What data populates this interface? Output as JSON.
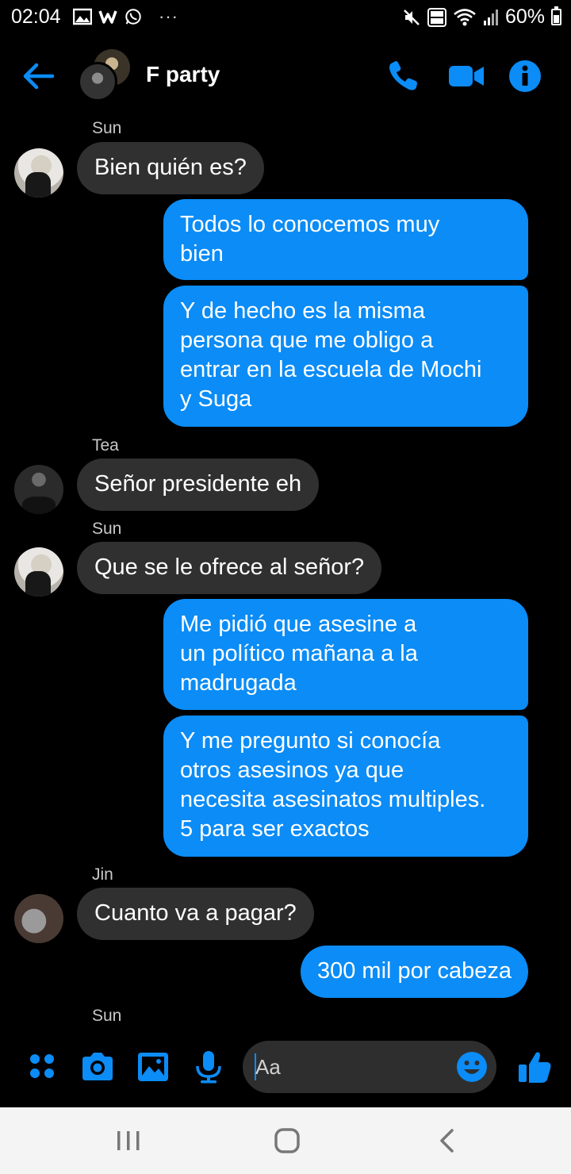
{
  "status_bar": {
    "time": "02:04",
    "battery": "60%",
    "battery_level": 0.6,
    "overflow": "···"
  },
  "header": {
    "title": "F party"
  },
  "messages": [
    {
      "sender": "Sun"
    },
    {
      "direction": "incoming",
      "avatar": "sun",
      "text": "Bien quién es?"
    },
    {
      "direction": "outgoing",
      "lines": [
        "Todos lo conocemos muy",
        "bien"
      ]
    },
    {
      "direction": "outgoing",
      "lines": [
        "Y de hecho es la misma",
        "persona que me obligo a",
        "entrar en la escuela de Mochi",
        "y Suga"
      ]
    },
    {
      "sender": "Tea"
    },
    {
      "direction": "incoming",
      "avatar": "tea",
      "text": "Señor presidente eh"
    },
    {
      "sender": "Sun"
    },
    {
      "direction": "incoming",
      "avatar": "sun",
      "text": "Que se le ofrece al señor?"
    },
    {
      "direction": "outgoing",
      "lines": [
        "Me pidió que asesine a",
        "un político mañana a la",
        "madrugada"
      ]
    },
    {
      "direction": "outgoing",
      "lines": [
        "Y me pregunto si conocía",
        "otros asesinos ya que",
        "necesita asesinatos multiples.",
        "5 para ser exactos"
      ]
    },
    {
      "sender": "Jin"
    },
    {
      "direction": "incoming",
      "avatar": "jin",
      "text": "Cuanto va a pagar?"
    },
    {
      "direction": "outgoing",
      "text": "300 mil por cabeza"
    },
    {
      "sender": "Sun"
    }
  ],
  "composer": {
    "placeholder": "Aa"
  },
  "colors": {
    "accent": "#0b8cf6",
    "incoming_bubble": "#303030",
    "background": "#000000",
    "nav_bar": "#f4f4f4"
  },
  "icons": {
    "header": [
      "back-arrow-icon",
      "phone-icon",
      "video-icon",
      "info-icon"
    ],
    "composer": [
      "apps-icon",
      "camera-icon",
      "gallery-icon",
      "microphone-icon",
      "emoji-icon",
      "thumbs-up-icon"
    ],
    "nav": [
      "recents-icon",
      "home-icon",
      "back-icon"
    ]
  }
}
